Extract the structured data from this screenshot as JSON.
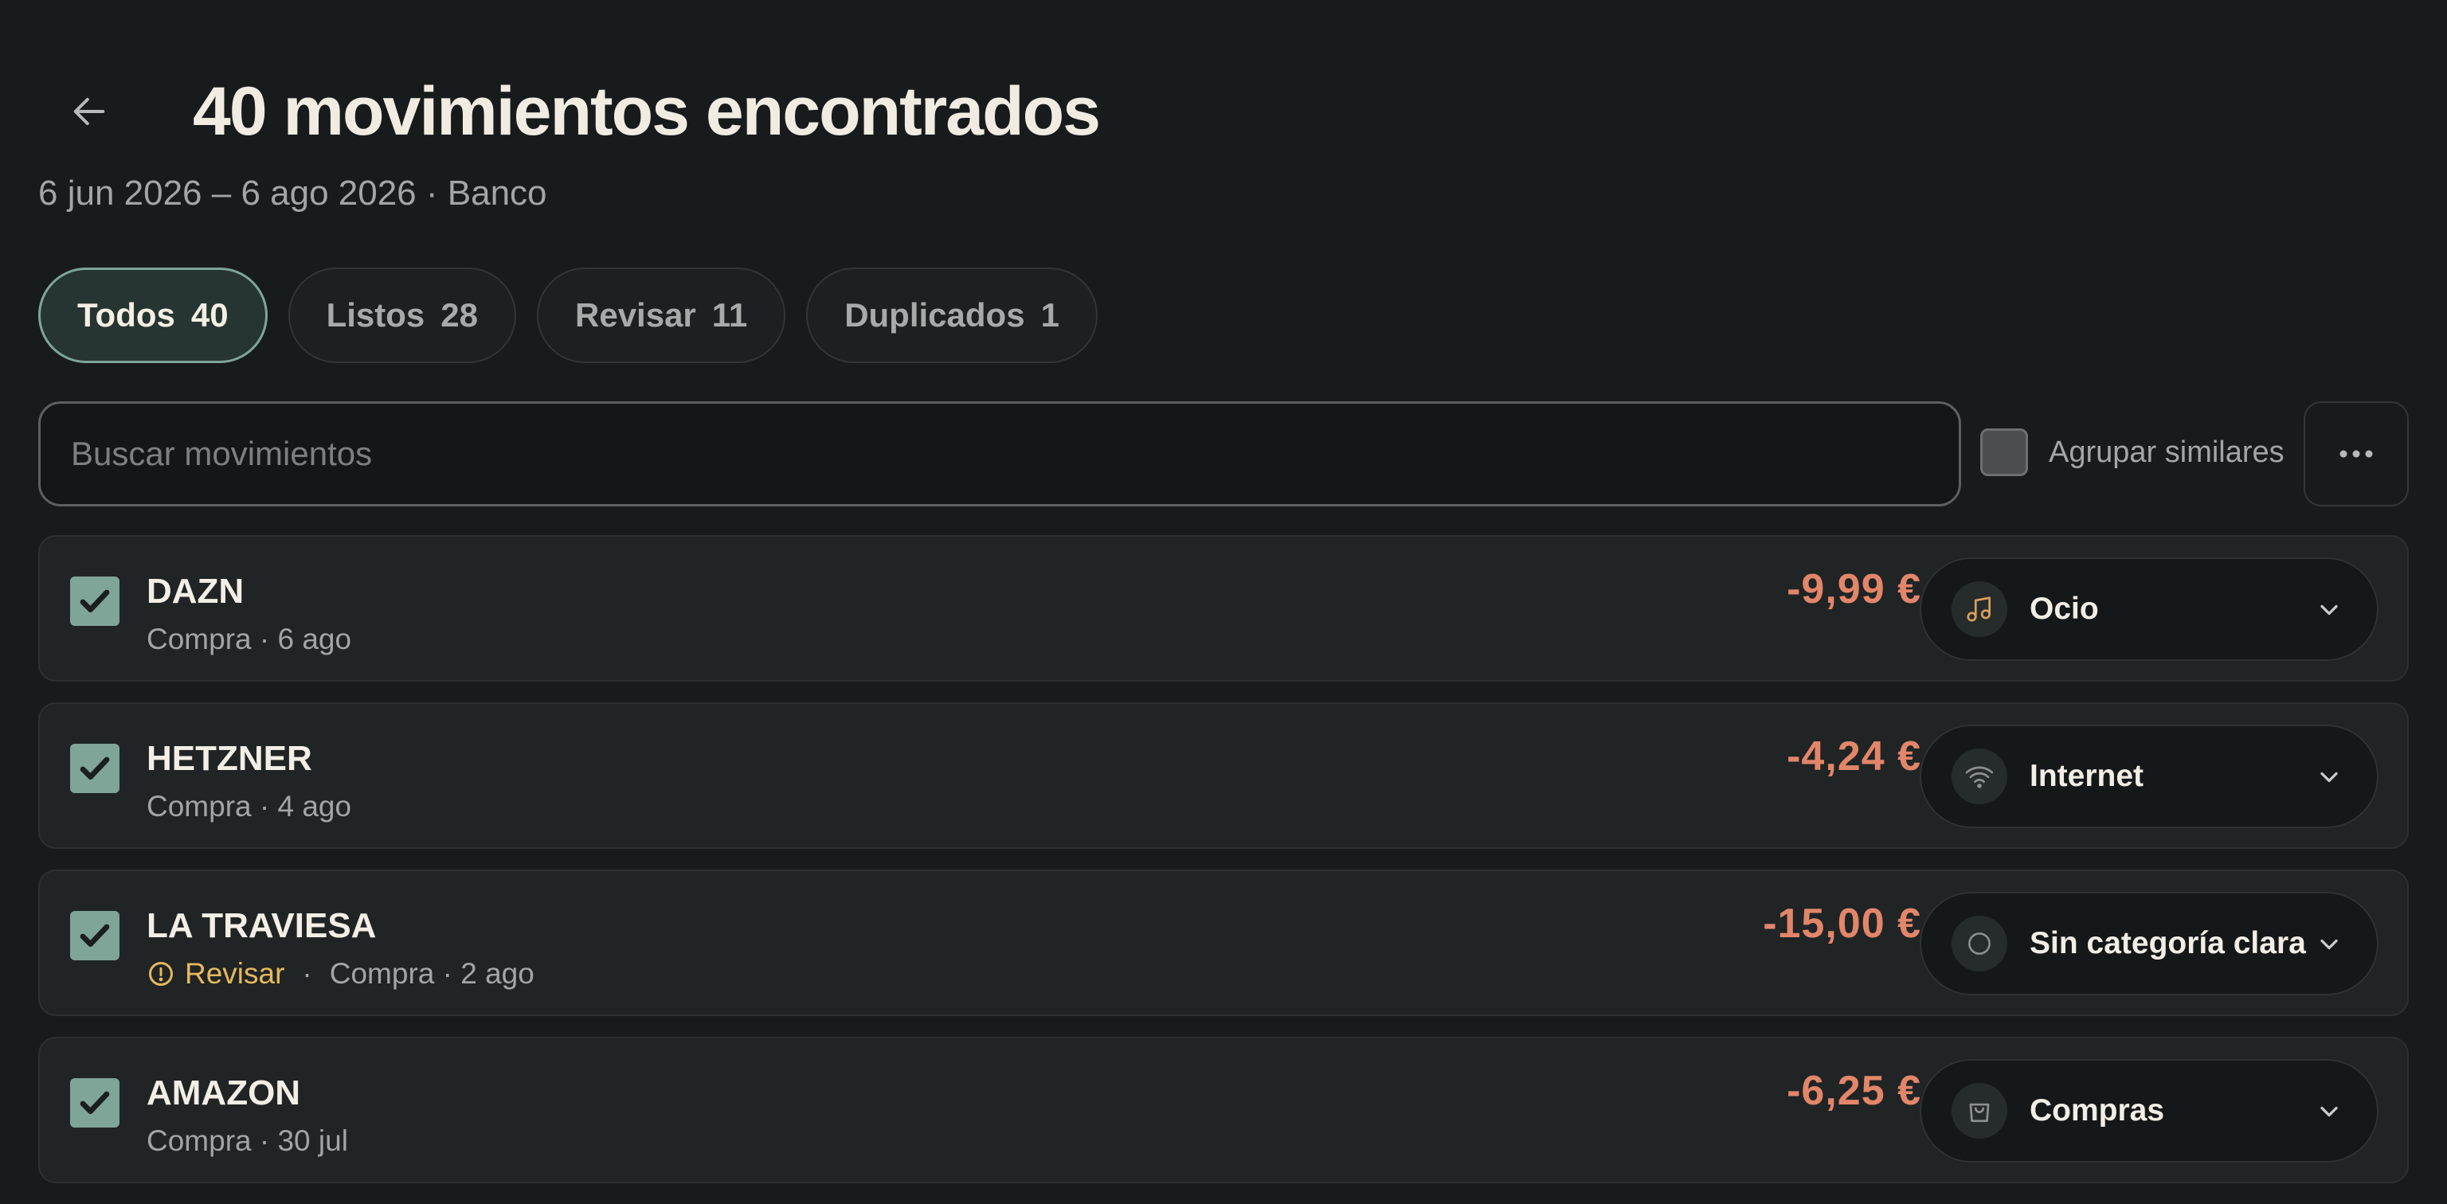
{
  "header": {
    "title": "40 movimientos encontrados",
    "subtitle": "6 jun 2026 – 6 ago 2026 · Banco"
  },
  "tabs": [
    {
      "label": "Todos",
      "count": "40",
      "active": true
    },
    {
      "label": "Listos",
      "count": "28",
      "active": false
    },
    {
      "label": "Revisar",
      "count": "11",
      "active": false
    },
    {
      "label": "Duplicados",
      "count": "1",
      "active": false
    }
  ],
  "search": {
    "placeholder": "Buscar movimientos",
    "value": ""
  },
  "group_similar": {
    "label": "Agrupar similares",
    "checked": false
  },
  "transactions": [
    {
      "name": "DAZN",
      "meta": "Compra · 6 ago",
      "amount": "-9,99 €",
      "category": "Ocio",
      "category_icon": "music-note-icon",
      "checked": true
    },
    {
      "name": "HETZNER",
      "meta": "Compra · 4 ago",
      "amount": "-4,24 €",
      "category": "Internet",
      "category_icon": "wifi-icon",
      "checked": true
    },
    {
      "name": "LA TRAVIESA",
      "review_label": "Revisar",
      "meta_dot": "·",
      "meta": "Compra · 2 ago",
      "amount": "-15,00 €",
      "category": "Sin categoría clara",
      "category_icon": "circle-icon",
      "checked": true
    },
    {
      "name": "AMAZON",
      "meta": "Compra · 30 jul",
      "amount": "-6,25 €",
      "category": "Compras",
      "category_icon": "shopping-bag-icon",
      "checked": true
    }
  ],
  "colors": {
    "background": "#181b1c",
    "accent": "#7fa598",
    "amount": "#e2866a",
    "review": "#e7b85e",
    "music_icon": "#d9a05b"
  }
}
